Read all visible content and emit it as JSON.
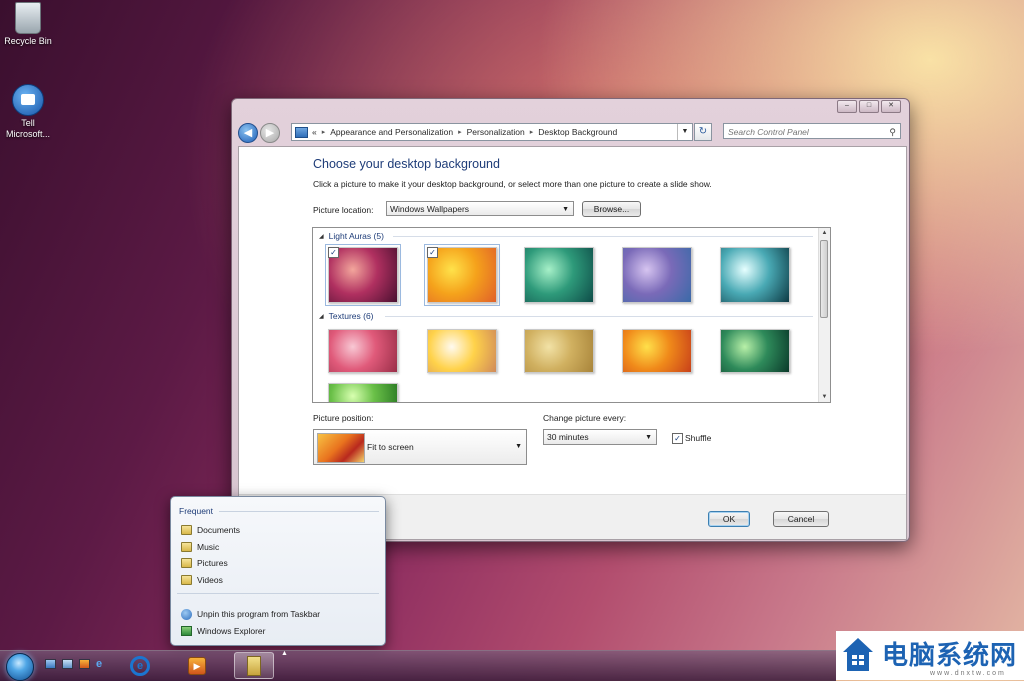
{
  "desktop": {
    "icons": [
      {
        "label": "Recycle Bin",
        "icon": "recycle-bin-icon"
      },
      {
        "label": "Tell Microsoft...",
        "icon": "feedback-icon"
      }
    ]
  },
  "window": {
    "controls": {
      "minimize": "–",
      "maximize": "□",
      "close": "✕"
    },
    "nav": {
      "back": "back-arrow-icon",
      "forward": "forward-arrow-icon",
      "breadcrumb": [
        "Appearance and Personalization",
        "Personalization",
        "Desktop Background"
      ],
      "separator": "▸",
      "overflow": "«",
      "search_placeholder": "Search Control Panel"
    },
    "title": "Choose your desktop background",
    "subtitle": "Click a picture to make it your desktop background, or select more than one picture to create a slide show.",
    "picture_location": {
      "label": "Picture location:",
      "value": "Windows Wallpapers",
      "browse_label": "Browse..."
    },
    "groups": [
      {
        "name": "Light Auras (5)",
        "thumbs": [
          {
            "name": "light-aura-1",
            "checked": true,
            "colors": [
              "#f3a69c",
              "#b03060",
              "#4a1030"
            ]
          },
          {
            "name": "light-aura-2",
            "checked": true,
            "colors": [
              "#ffe24a",
              "#f5a21b",
              "#e0602a"
            ]
          },
          {
            "name": "light-aura-3",
            "checked": false,
            "colors": [
              "#a6f0c8",
              "#2e9a7a",
              "#0e4c48"
            ]
          },
          {
            "name": "light-aura-4",
            "checked": false,
            "colors": [
              "#d6c4f0",
              "#7a6ab8",
              "#3a6aa8"
            ]
          },
          {
            "name": "light-aura-5",
            "checked": false,
            "colors": [
              "#e6ffff",
              "#49a9b4",
              "#0d3a44"
            ]
          }
        ]
      },
      {
        "name": "Textures (6)",
        "thumbs": [
          {
            "name": "texture-pink-flower",
            "checked": false,
            "colors": [
              "#f8c8d4",
              "#e05a7a",
              "#9a2e48"
            ]
          },
          {
            "name": "texture-frangipani",
            "checked": false,
            "colors": [
              "#fffaf0",
              "#ffd24a",
              "#d08a5a"
            ]
          },
          {
            "name": "texture-pattern",
            "checked": false,
            "colors": [
              "#f2e2a6",
              "#d0b060",
              "#a8843a"
            ]
          },
          {
            "name": "texture-gerbera",
            "checked": false,
            "colors": [
              "#ffe04a",
              "#f08a1a",
              "#c8401a"
            ]
          },
          {
            "name": "texture-leaves",
            "checked": false,
            "colors": [
              "#b8f0a8",
              "#2e8a5a",
              "#0a3a2a"
            ]
          },
          {
            "name": "texture-green",
            "checked": false,
            "colors": [
              "#d8ffb0",
              "#6ac048",
              "#2a7a24"
            ]
          }
        ]
      }
    ],
    "picture_position": {
      "label": "Picture position:",
      "value": "Fit to screen"
    },
    "change_picture": {
      "label": "Change picture every:",
      "value": "30 minutes"
    },
    "shuffle": {
      "label": "Shuffle",
      "checked": true
    },
    "ok_label": "OK",
    "cancel_label": "Cancel"
  },
  "jumplist": {
    "header": "Frequent",
    "items": [
      "Documents",
      "Music",
      "Pictures",
      "Videos"
    ],
    "tasks": [
      "Unpin this program from Taskbar",
      "Windows Explorer"
    ]
  },
  "taskbar": {
    "programs": [
      "Internet Explorer",
      "Windows Media Player",
      "Windows Explorer"
    ]
  },
  "watermark": {
    "text": "电脑系统网",
    "url": "www.dnxtw.com"
  }
}
